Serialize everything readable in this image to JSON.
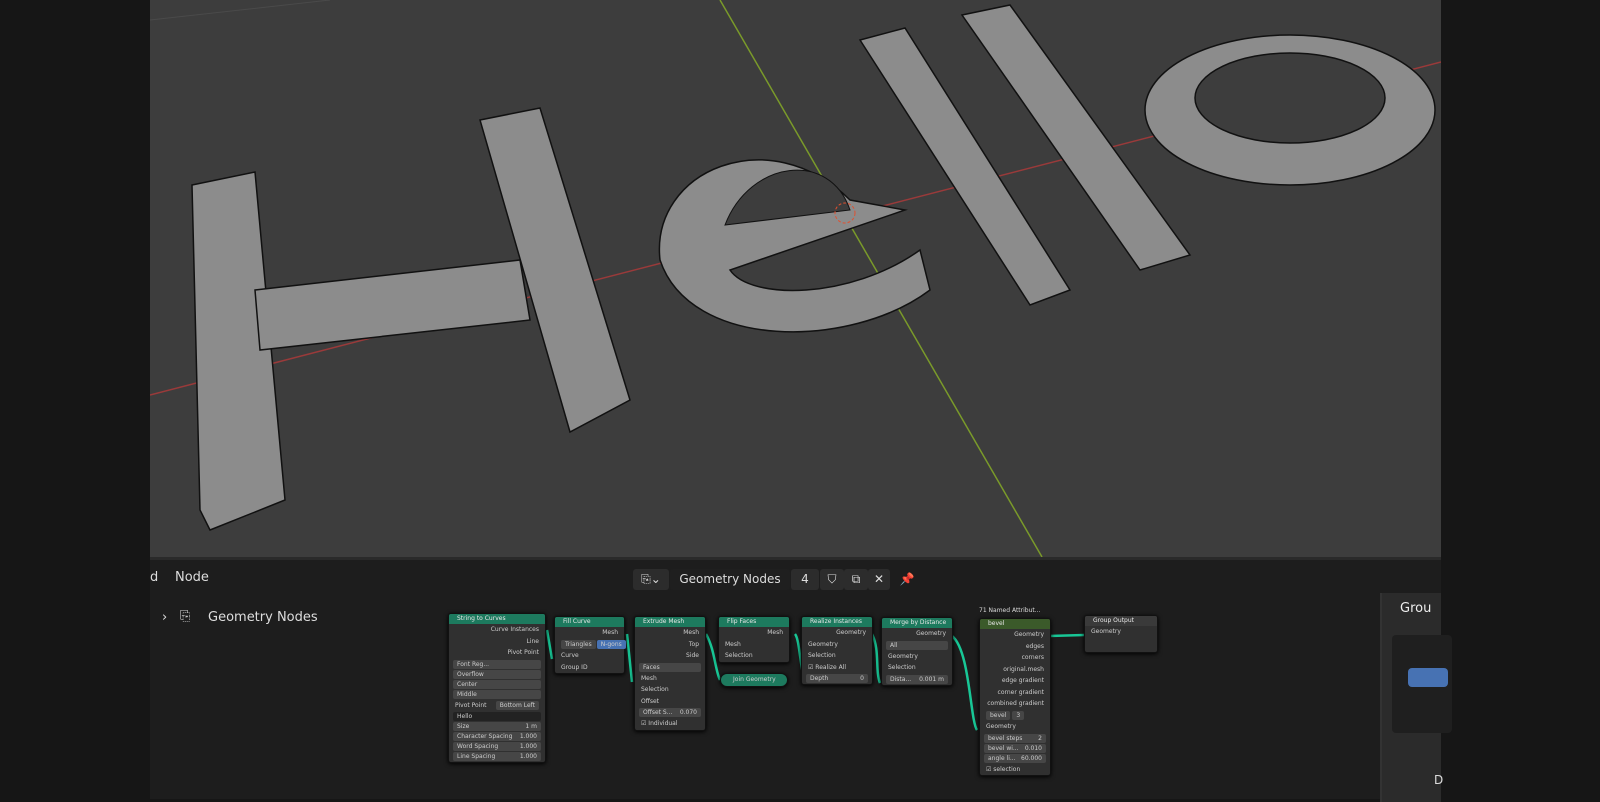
{
  "viewport": {
    "text_object": "Hello"
  },
  "editor_header": {
    "menu_partial": "d",
    "menu_node": "Node",
    "tree_name": "Geometry Nodes",
    "users": "4"
  },
  "outliner": {
    "item": "Geometry Nodes"
  },
  "nodes": {
    "string_to_curves": {
      "title": "String to Curves",
      "outputs": [
        "Curve Instances",
        "Line",
        "Pivot Point"
      ],
      "font": "Font Reg...",
      "overflow": "Overflow",
      "align_x": "Center",
      "align_y": "Middle",
      "pivot_label": "Pivot Point",
      "pivot_value": "Bottom Left",
      "string": "Hello",
      "size_label": "Size",
      "size": "1 m",
      "char_label": "Character Spacing",
      "char": "1.000",
      "word_label": "Word Spacing",
      "word": "1.000",
      "line_label": "Line Spacing",
      "line": "1.000"
    },
    "fill_curve": {
      "title": "Fill Curve",
      "output": "Mesh",
      "mode_a": "Triangles",
      "mode_b": "N-gons",
      "inputs": [
        "Curve",
        "Group ID"
      ]
    },
    "extrude_mesh": {
      "title": "Extrude Mesh",
      "outputs": [
        "Mesh",
        "Top",
        "Side"
      ],
      "mode": "Faces",
      "inputs": [
        "Mesh",
        "Selection",
        "Offset"
      ],
      "offset_scale_label": "Offset S...",
      "offset_scale": "0.070",
      "individual": "Individual"
    },
    "flip_faces": {
      "title": "Flip Faces",
      "output": "Mesh",
      "inputs": [
        "Mesh",
        "Selection"
      ]
    },
    "join_geometry": {
      "title": "Join Geometry"
    },
    "realize_instances": {
      "title": "Realize Instances",
      "output": "Geometry",
      "inputs": [
        "Geometry",
        "Selection"
      ],
      "realize_all": "Realize All",
      "depth_label": "Depth",
      "depth": "0"
    },
    "merge_by_distance": {
      "title": "Merge by Distance",
      "output": "Geometry",
      "mode": "All",
      "inputs": [
        "Geometry",
        "Selection"
      ],
      "dist_label": "Dista...",
      "dist": "0.001 m"
    },
    "bevel_group": {
      "label": "71 Named Attribut...",
      "title": "bevel",
      "outputs": [
        "Geometry",
        "edges",
        "corners",
        "original.mesh",
        "edge gradient",
        "corner gradient",
        "combined gradient"
      ],
      "tree": "bevel",
      "users": "3",
      "input": "Geometry",
      "steps_label": "bevel steps",
      "steps": "2",
      "width_label": "bevel wi...",
      "width": "0.010",
      "angle_label": "angle li...",
      "angle": "60.000",
      "selection": "selection"
    },
    "group_output": {
      "title": "Group Output",
      "input": "Geometry"
    }
  },
  "sidebar": {
    "panel_title": "Grou",
    "bottom": "D"
  },
  "colors": {
    "node_header": "#1d7a5e",
    "socket_geometry": "#00d6a3",
    "viewport_bg": "#3d3d3d"
  }
}
